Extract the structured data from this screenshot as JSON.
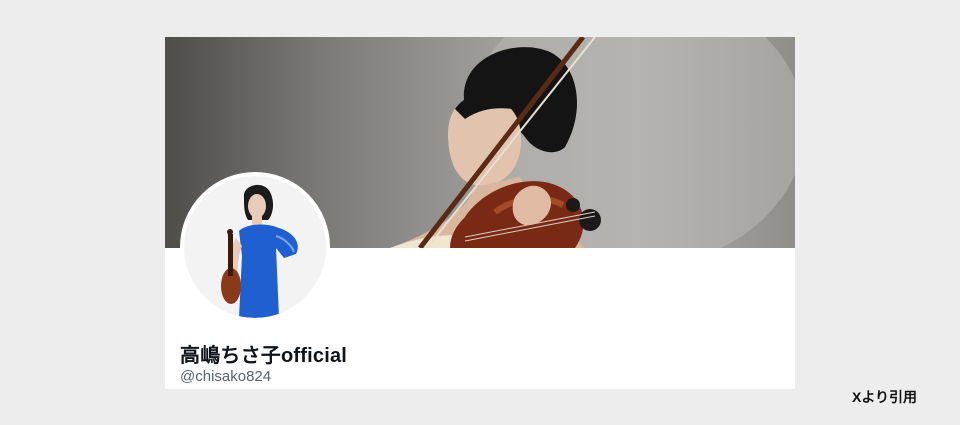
{
  "profile": {
    "display_name": "高嶋ちさ子official",
    "handle": "@chisako824"
  },
  "source_note": "Xより引用",
  "colors": {
    "page_background": "#ededed",
    "card_background": "#ffffff",
    "name_text": "#0f1419",
    "handle_text": "#536471",
    "avatar_dress": "#1f5fd0"
  },
  "icons": {
    "banner": "violinist-banner-photo",
    "avatar": "violinist-profile-photo"
  }
}
